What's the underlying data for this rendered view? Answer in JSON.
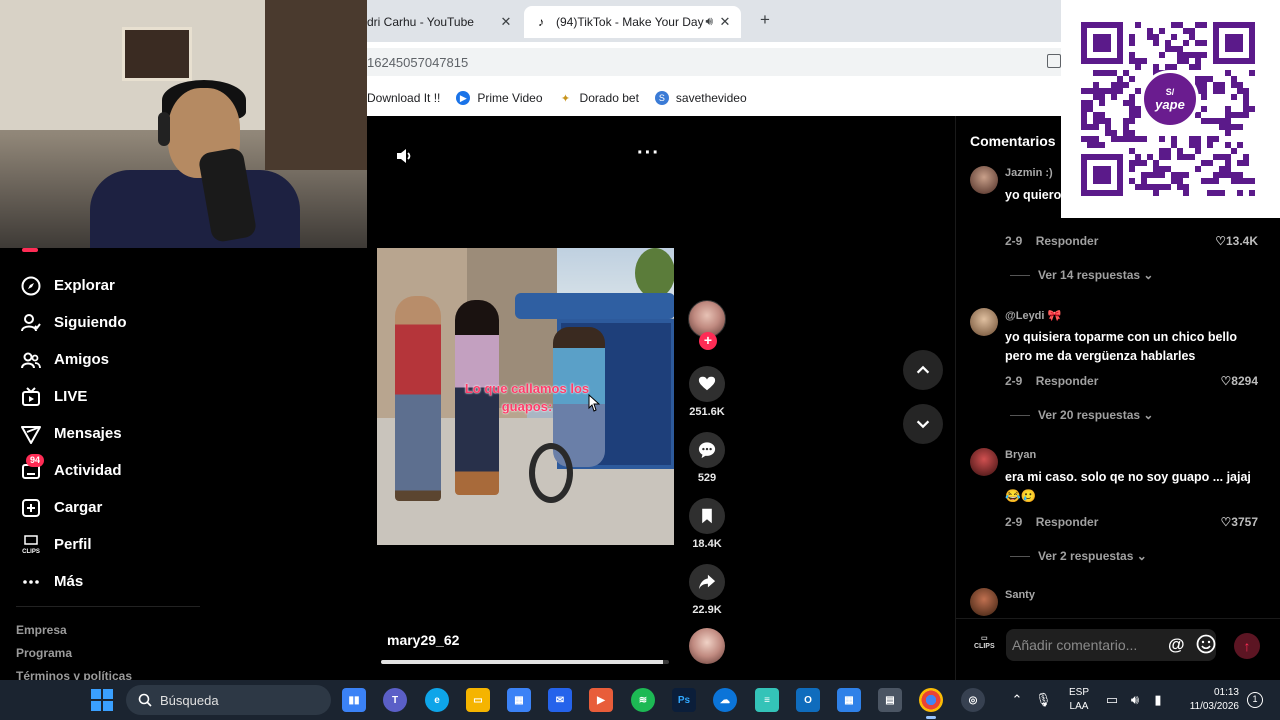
{
  "browser": {
    "tabs": [
      {
        "label": "dri Carhu - YouTube"
      },
      {
        "label": "(94)TikTok - Make Your Day"
      }
    ],
    "url": "16245057047815",
    "bookmarks": [
      {
        "label": "Download It !!"
      },
      {
        "label": "Prime Video"
      },
      {
        "label": "Dorado bet"
      },
      {
        "label": "savethevideo"
      }
    ]
  },
  "sidebar": {
    "items": [
      {
        "label": "Explorar",
        "icon": "compass-icon"
      },
      {
        "label": "Siguiendo",
        "icon": "user-follow-icon"
      },
      {
        "label": "Amigos",
        "icon": "friends-icon"
      },
      {
        "label": "LIVE",
        "icon": "live-tv-icon"
      },
      {
        "label": "Mensajes",
        "icon": "paper-plane-icon"
      },
      {
        "label": "Actividad",
        "icon": "inbox-icon",
        "badge": "94"
      },
      {
        "label": "Cargar",
        "icon": "plus-square-icon"
      },
      {
        "label": "Perfil",
        "icon": "profile-clips-icon"
      },
      {
        "label": "Más",
        "icon": "more-dots-icon"
      }
    ],
    "footer": [
      "Empresa",
      "Programa",
      "Términos y políticas"
    ]
  },
  "video": {
    "caption": "Lo que callamos los guapos:",
    "username": "mary29_62",
    "progress": 0.98,
    "stats": {
      "likes": "251.6K",
      "comments": "529",
      "saves": "18.4K",
      "shares": "22.9K"
    }
  },
  "comments": {
    "title": "Comentarios",
    "list": [
      {
        "user": "Jazmin :)",
        "text": "yo quiero día",
        "date": "2-9",
        "reply": "Responder",
        "likes": "13.4K",
        "replies": "Ver 14 respuestas"
      },
      {
        "user": "@Leydi 🎀",
        "text": "yo quisiera toparme con un chico bello pero me da vergüenza hablarles",
        "date": "2-9",
        "reply": "Responder",
        "likes": "8294",
        "replies": "Ver 20 respuestas"
      },
      {
        "user": "Bryan",
        "text": "era mi caso. solo qe no soy guapo ... jajaj 😂🥲",
        "date": "2-9",
        "reply": "Responder",
        "likes": "3757",
        "replies": "Ver 2 respuestas"
      },
      {
        "user": "Santy"
      }
    ],
    "input_placeholder": "Añadir comentario...",
    "clips_label": "CLIPS"
  },
  "qr": {
    "brand": "yape",
    "currency": "S/"
  },
  "taskbar": {
    "search": "Búsqueda",
    "lang_top": "ESP",
    "lang_bottom": "LAA",
    "time": "01:13",
    "date": "11/03/2026"
  },
  "colors": {
    "accent": "#fe2c55",
    "qr_purple": "#5b1a8a",
    "taskbar_bg": "#1b2430"
  }
}
